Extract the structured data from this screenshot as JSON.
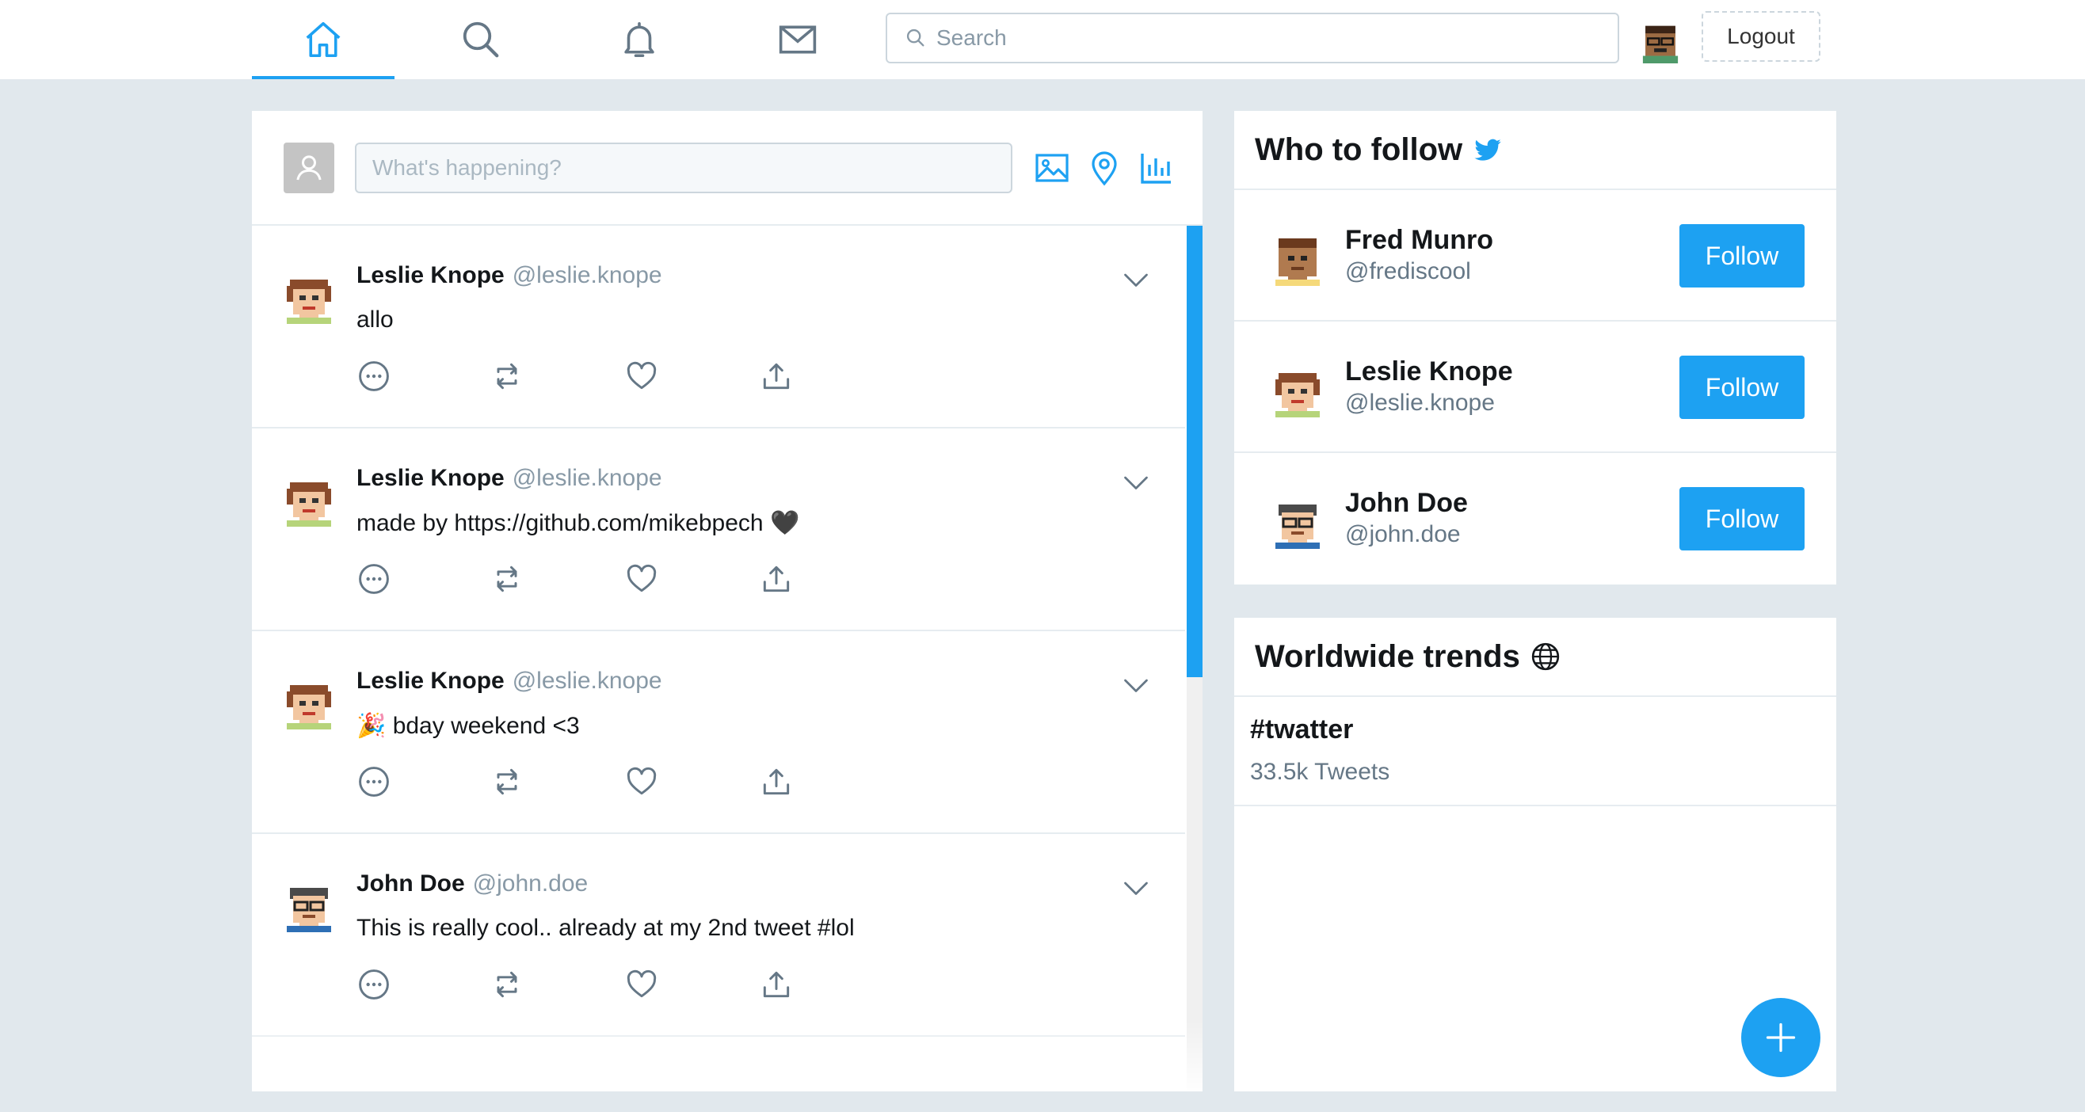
{
  "colors": {
    "accent": "#1da1f2",
    "background": "#e1e8ed"
  },
  "nav": {
    "tabs": [
      {
        "name": "home",
        "icon": "home-icon",
        "active": true
      },
      {
        "name": "explore",
        "icon": "search-icon",
        "active": false
      },
      {
        "name": "notifications",
        "icon": "bell-icon",
        "active": false
      },
      {
        "name": "messages",
        "icon": "mail-icon",
        "active": false
      }
    ],
    "search_placeholder": "Search",
    "logout_label": "Logout"
  },
  "composer": {
    "placeholder": "What's happening?",
    "tools": [
      "image-icon",
      "location-pin-icon",
      "poll-chart-icon"
    ]
  },
  "tweets": [
    {
      "name": "Leslie Knope",
      "handle": "@leslie.knope",
      "text": "allo",
      "avatar": "leslie-avatar"
    },
    {
      "name": "Leslie Knope",
      "handle": "@leslie.knope",
      "text": "made by https://github.com/mikebpech 🖤",
      "avatar": "leslie-avatar"
    },
    {
      "name": "Leslie Knope",
      "handle": "@leslie.knope",
      "text": "🎉 bday weekend <3",
      "avatar": "leslie-avatar"
    },
    {
      "name": "John Doe",
      "handle": "@john.doe",
      "text": "This is really cool.. already at my 2nd tweet #lol",
      "avatar": "john-avatar"
    }
  ],
  "who_to_follow": {
    "title": "Who to follow",
    "follow_label": "Follow",
    "users": [
      {
        "name": "Fred Munro",
        "handle": "@frediscool",
        "avatar": "fred-avatar"
      },
      {
        "name": "Leslie Knope",
        "handle": "@leslie.knope",
        "avatar": "leslie-avatar"
      },
      {
        "name": "John Doe",
        "handle": "@john.doe",
        "avatar": "john-avatar"
      }
    ]
  },
  "trends": {
    "title": "Worldwide trends",
    "items": [
      {
        "tag": "#twatter",
        "count": "33.5k Tweets"
      }
    ]
  }
}
